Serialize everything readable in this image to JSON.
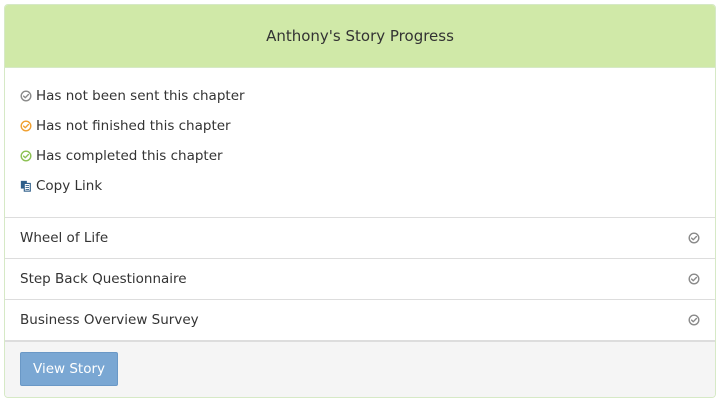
{
  "panel": {
    "title": "Anthony's Story Progress"
  },
  "legend": {
    "items": [
      {
        "label": "Has not been sent this chapter",
        "icon": "check-circle-icon",
        "color": "#8a8a8a"
      },
      {
        "label": "Has not finished this chapter",
        "icon": "check-circle-icon",
        "color": "#f0a030"
      },
      {
        "label": "Has completed this chapter",
        "icon": "check-circle-icon",
        "color": "#8cc152"
      }
    ],
    "copy_link": {
      "label": "Copy Link",
      "icon": "copy-icon",
      "color": "#2f5f8a"
    }
  },
  "chapters": [
    {
      "label": "Wheel of Life",
      "status": "not-sent",
      "icon": "check-circle-icon",
      "color": "#8a8a8a"
    },
    {
      "label": "Step Back Questionnaire",
      "status": "not-sent",
      "icon": "check-circle-icon",
      "color": "#8a8a8a"
    },
    {
      "label": "Business Overview Survey",
      "status": "not-sent",
      "icon": "check-circle-icon",
      "color": "#8a8a8a"
    }
  ],
  "footer": {
    "view_story_label": "View Story"
  }
}
